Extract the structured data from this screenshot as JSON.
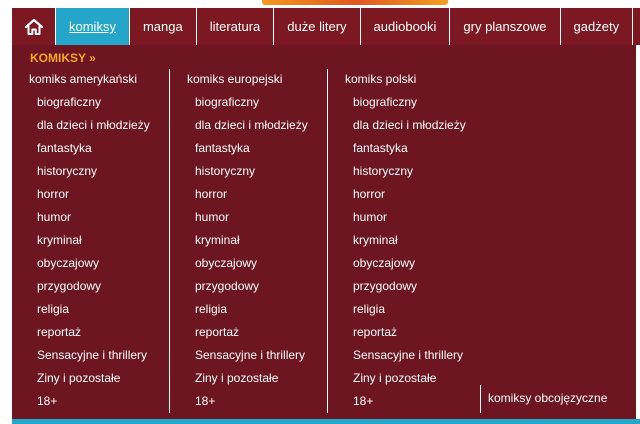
{
  "nav": {
    "items": [
      {
        "label": "komiksy",
        "active": true
      },
      {
        "label": "manga"
      },
      {
        "label": "literatura"
      },
      {
        "label": "duże litery"
      },
      {
        "label": "audiobooki"
      },
      {
        "label": "gry planszowe"
      },
      {
        "label": "gadżety"
      }
    ],
    "home_icon": "home-icon"
  },
  "dropdown": {
    "title": "KOMIKSY »",
    "columns": [
      {
        "heading": "komiks amerykański",
        "items": [
          "biograficzny",
          "dla dzieci i młodzieży",
          "fantastyka",
          "historyczny",
          "horror",
          "humor",
          "kryminał",
          "obyczajowy",
          "przygodowy",
          "religia",
          "reportaż",
          "Sensacyjne i thrillery",
          "Ziny i pozostałe",
          "18+"
        ]
      },
      {
        "heading": "komiks europejski",
        "items": [
          "biograficzny",
          "dla dzieci i młodzieży",
          "fantastyka",
          "historyczny",
          "horror",
          "humor",
          "kryminał",
          "obyczajowy",
          "przygodowy",
          "religia",
          "reportaż",
          "Sensacyjne i thrillery",
          "Ziny i pozostałe",
          "18+"
        ]
      },
      {
        "heading": "komiks polski",
        "items": [
          "biograficzny",
          "dla dzieci i młodzieży",
          "fantastyka",
          "historyczny",
          "horror",
          "humor",
          "kryminał",
          "obyczajowy",
          "przygodowy",
          "religia",
          "reportaż",
          "Sensacyjne i thrillery",
          "Ziny i pozostałe",
          "18+"
        ]
      }
    ],
    "extra_link": "komiksy obcojęzyczne"
  },
  "colors": {
    "nav_bg": "#7b1821",
    "panel_bg": "#6d1520",
    "active_tab": "#23a6c9",
    "title_accent": "#f5a623"
  }
}
